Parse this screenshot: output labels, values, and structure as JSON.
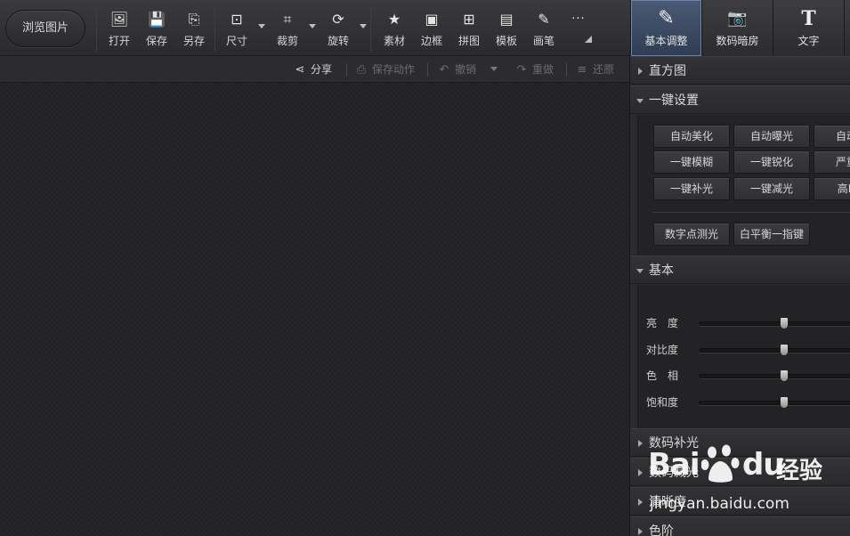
{
  "toolbar": {
    "browse_label": "浏览图片",
    "tools": [
      {
        "label": "打开",
        "icon": "open-image-icon",
        "glyph": "🖼"
      },
      {
        "label": "保存",
        "icon": "save-icon",
        "glyph": "💾"
      },
      {
        "label": "另存",
        "icon": "save-as-icon",
        "glyph": "⎘"
      },
      {
        "label": "尺寸",
        "icon": "resize-icon",
        "glyph": "⊡"
      },
      {
        "label": "裁剪",
        "icon": "crop-icon",
        "glyph": "⌗"
      },
      {
        "label": "旋转",
        "icon": "rotate-icon",
        "glyph": "⟳"
      },
      {
        "label": "素材",
        "icon": "material-star-icon",
        "glyph": "★"
      },
      {
        "label": "边框",
        "icon": "border-frame-icon",
        "glyph": "▣"
      },
      {
        "label": "拼图",
        "icon": "collage-grid-icon",
        "glyph": "⊞"
      },
      {
        "label": "模板",
        "icon": "template-icon",
        "glyph": "▤"
      },
      {
        "label": "画笔",
        "icon": "brush-icon",
        "glyph": "✎"
      },
      {
        "label": "",
        "icon": "more-dots-icon",
        "glyph": "···"
      }
    ],
    "modes": [
      {
        "label": "基本调整",
        "icon": "basic-adjust-icon",
        "glyph": "✎",
        "active": true
      },
      {
        "label": "数码暗房",
        "icon": "camera-darkroom-icon",
        "glyph": "📷",
        "active": false
      },
      {
        "label": "文字",
        "icon": "text-T-icon",
        "glyph": "T",
        "active": false
      }
    ]
  },
  "subbar": {
    "share": "分享",
    "save_action": "保存动作",
    "undo": "撤销",
    "redo": "重做",
    "restore": "还原"
  },
  "panel": {
    "histogram": "直方图",
    "one_key": "一键设置",
    "one_key_buttons": [
      "自动美化",
      "自动曝光",
      "自动白",
      "一键模糊",
      "一键锐化",
      "严重白",
      "一键补光",
      "一键减光",
      "高ISO"
    ],
    "extra_buttons": [
      "数字点测光",
      "白平衡一指键"
    ],
    "basic": "基本",
    "sliders": [
      {
        "label": "亮　度",
        "value": 0.5
      },
      {
        "label": "对比度",
        "value": 0.5
      },
      {
        "label": "色　相",
        "value": 0.5
      },
      {
        "label": "饱和度",
        "value": 0.5
      }
    ],
    "collapsed_sections": [
      "数码补光",
      "数码减光",
      "清晰度",
      "色阶"
    ]
  },
  "watermark": {
    "brand": "Bai",
    "brand2": "du",
    "cn": "经验",
    "url": "jingyan.baidu.com"
  }
}
